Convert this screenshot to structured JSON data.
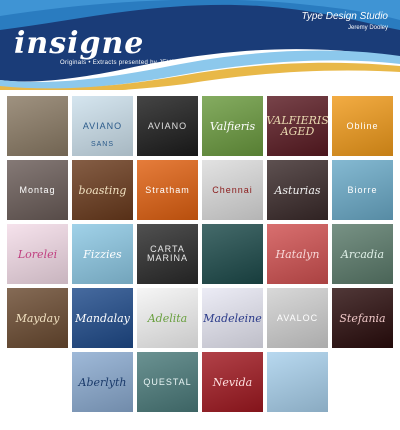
{
  "header": {
    "logo": "insigne",
    "tagline": "Originals • Extracts presented by JEVS",
    "studio": "Type Design Studio",
    "author": "Jeremy Dooley",
    "colors": {
      "dark_blue": "#1a3c78",
      "mid_blue": "#2a7cc0",
      "light_blue": "#8cc8ec",
      "gold": "#e8b848"
    }
  },
  "tiles": [
    {
      "label": "",
      "bg": "#8a7a64",
      "fg": "#d06040"
    },
    {
      "label": "AVIANO",
      "sub": "SANS",
      "bg": "#cce0ec",
      "fg": "#2a5a8a",
      "upright": true
    },
    {
      "label": "AVIANO",
      "bg": "#1c1c1c",
      "fg": "#e0e0e0",
      "upright": true
    },
    {
      "label": "Valfieris",
      "bg": "#6a9a3e",
      "fg": "#ffffff"
    },
    {
      "label": "VALFIERIS AGED",
      "bg": "#5a1a22",
      "fg": "#e8d8b0"
    },
    {
      "label": "Obline",
      "bg": "#f09a1a",
      "fg": "#ffffff",
      "upright": true
    },
    {
      "label": "Montag",
      "bg": "#6a5c58",
      "fg": "#ffffff",
      "upright": true
    },
    {
      "label": "boasting",
      "bg": "#6a3a1c",
      "fg": "#f0e0c0"
    },
    {
      "label": "Stratham",
      "bg": "#e06010",
      "fg": "#ffffff",
      "upright": true
    },
    {
      "label": "Chennai",
      "bg": "#dcdcdc",
      "fg": "#8a1a1a",
      "upright": true
    },
    {
      "label": "Asturias",
      "bg": "#3a2a2a",
      "fg": "#f0f0f0"
    },
    {
      "label": "Biorre",
      "bg": "#6aaac8",
      "fg": "#ffffff",
      "upright": true
    },
    {
      "label": "Lorelei",
      "bg": "#f4dce8",
      "fg": "#c04080"
    },
    {
      "label": "Fizzies",
      "bg": "#8cc8e4",
      "fg": "#ffffff"
    },
    {
      "label": "CARTA MARINA",
      "bg": "#2a2a2a",
      "fg": "#e8e8e8",
      "upright": true
    },
    {
      "label": "",
      "bg": "#1c4a4a",
      "fg": "#a0d040"
    },
    {
      "label": "Hatalyn",
      "bg": "#d05050",
      "fg": "#f8d8d8"
    },
    {
      "label": "Arcadia",
      "bg": "#5a7a6a",
      "fg": "#e0f0e8"
    },
    {
      "label": "Mayday",
      "bg": "#6a4a30",
      "fg": "#f0e0c0"
    },
    {
      "label": "Mandalay",
      "bg": "#1e4a8a",
      "fg": "#ffffff"
    },
    {
      "label": "Adelita",
      "bg": "#f4f4f4",
      "fg": "#6aa040"
    },
    {
      "label": "Madeleine",
      "bg": "#e8e8f4",
      "fg": "#2a3a8a"
    },
    {
      "label": "AVALOC",
      "bg": "#d0d0d0",
      "fg": "#ffffff",
      "upright": true
    },
    {
      "label": "Stefania",
      "bg": "#2a0c0c",
      "fg": "#f0c8c8"
    },
    {
      "label": "Aberlyth",
      "bg": "#8aaad0",
      "fg": "#1a3a6a"
    },
    {
      "label": "QUESTAL",
      "bg": "#4a7a7a",
      "fg": "#e8f4f4",
      "upright": true
    },
    {
      "label": "Nevida",
      "bg": "#a01820",
      "fg": "#ffe0e0"
    },
    {
      "label": "",
      "bg": "#a8d0ec",
      "fg": "#ffffff"
    }
  ]
}
